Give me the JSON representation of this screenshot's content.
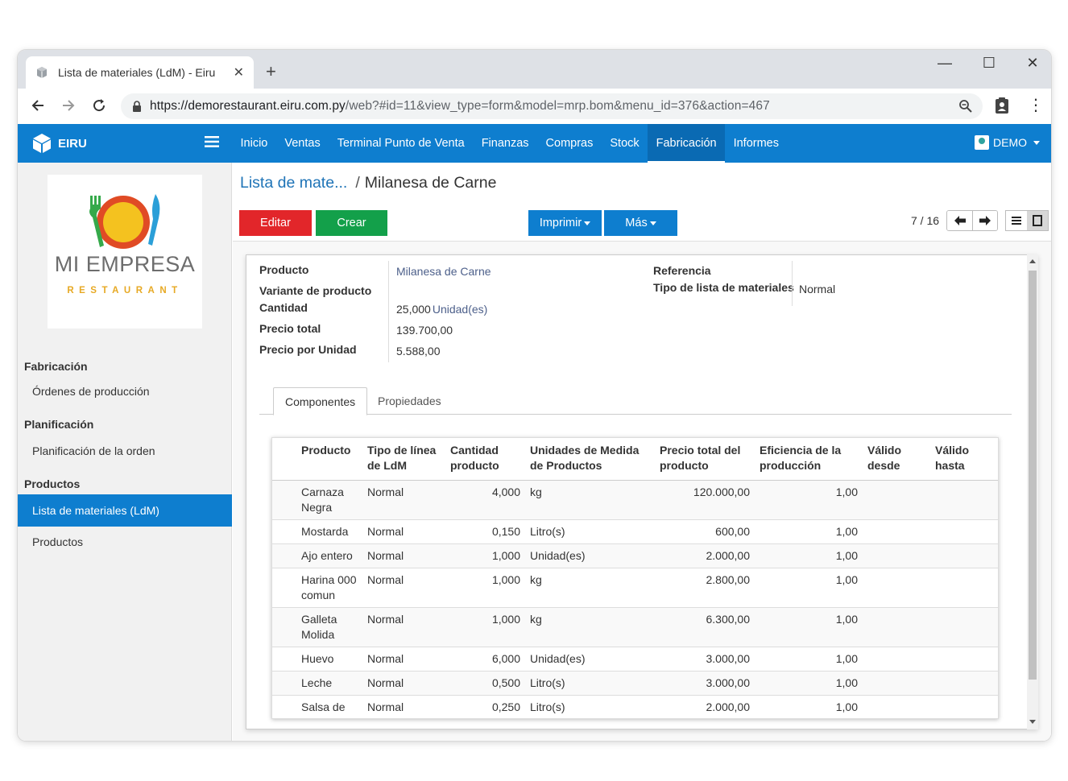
{
  "browser": {
    "tab_title": "Lista de materiales (LdM) - Eiru",
    "new_tab": "+",
    "url_host": "https://demorestaurant.eiru.com.py",
    "url_rest": "/web?#id=11&view_type=form&model=mrp.bom&menu_id=376&action=467",
    "menu_glyph": "⋮"
  },
  "navbar": {
    "brand": "EIRU",
    "menu": [
      "Inicio",
      "Ventas",
      "Terminal Punto de Venta",
      "Finanzas",
      "Compras",
      "Stock",
      "Fabricación",
      "Informes"
    ],
    "active_menu": "Fabricación",
    "user": "DEMO",
    "colors": {
      "primary": "#0e7ecf",
      "active": "#0a6ab3"
    }
  },
  "sidebar": {
    "logo_main": "MI EMPRESA",
    "logo_sub": "RESTAURANT",
    "sections": [
      {
        "title": "Fabricación",
        "items": [
          "Órdenes de producción"
        ]
      },
      {
        "title": "Planificación",
        "items": [
          "Planificación de la orden"
        ]
      },
      {
        "title": "Productos",
        "items": [
          "Lista de materiales (LdM)",
          "Productos"
        ]
      }
    ],
    "active_item": "Lista de materiales (LdM)"
  },
  "control": {
    "breadcrumb_link": "Lista de mate...",
    "breadcrumb_sep": "/",
    "breadcrumb_current": "Milanesa de Carne",
    "btn_edit": "Editar",
    "btn_create": "Crear",
    "btn_print": "Imprimir",
    "btn_more": "Más",
    "pager": "7 / 16",
    "colors": {
      "edit": "#e2262a",
      "create": "#13a04a"
    }
  },
  "form": {
    "labels": {
      "producto": "Producto",
      "variante": "Variante de producto",
      "cantidad": "Cantidad",
      "precio_total": "Precio total",
      "precio_unidad": "Precio por Unidad",
      "referencia": "Referencia",
      "tipo_lista": "Tipo de lista de materiales"
    },
    "values": {
      "producto": "Milanesa de Carne",
      "cantidad": "25,000",
      "cantidad_unit": "Unidad(es)",
      "precio_total": "139.700,00",
      "precio_unidad": "5.588,00",
      "tipo_lista": "Normal"
    },
    "tabs": [
      "Componentes",
      "Propiedades"
    ],
    "active_tab": "Componentes"
  },
  "table": {
    "headers": [
      "Producto",
      "Tipo de línea de LdM",
      "Cantidad producto",
      "Unidades de Medida de Productos",
      "Precio total del producto",
      "Eficiencia de la producción",
      "Válido desde",
      "Válido hasta"
    ],
    "rows": [
      [
        "Carnaza Negra",
        "Normal",
        "4,000",
        "kg",
        "120.000,00",
        "1,00",
        "",
        ""
      ],
      [
        "Mostarda",
        "Normal",
        "0,150",
        "Litro(s)",
        "600,00",
        "1,00",
        "",
        ""
      ],
      [
        "Ajo entero",
        "Normal",
        "1,000",
        "Unidad(es)",
        "2.000,00",
        "1,00",
        "",
        ""
      ],
      [
        "Harina 000 comun",
        "Normal",
        "1,000",
        "kg",
        "2.800,00",
        "1,00",
        "",
        ""
      ],
      [
        "Galleta Molida",
        "Normal",
        "1,000",
        "kg",
        "6.300,00",
        "1,00",
        "",
        ""
      ],
      [
        "Huevo",
        "Normal",
        "6,000",
        "Unidad(es)",
        "3.000,00",
        "1,00",
        "",
        ""
      ],
      [
        "Leche",
        "Normal",
        "0,500",
        "Litro(s)",
        "3.000,00",
        "1,00",
        "",
        ""
      ],
      [
        "Salsa de Soja",
        "Normal",
        "0,250",
        "Litro(s)",
        "2.000,00",
        "1,00",
        "",
        ""
      ]
    ]
  }
}
